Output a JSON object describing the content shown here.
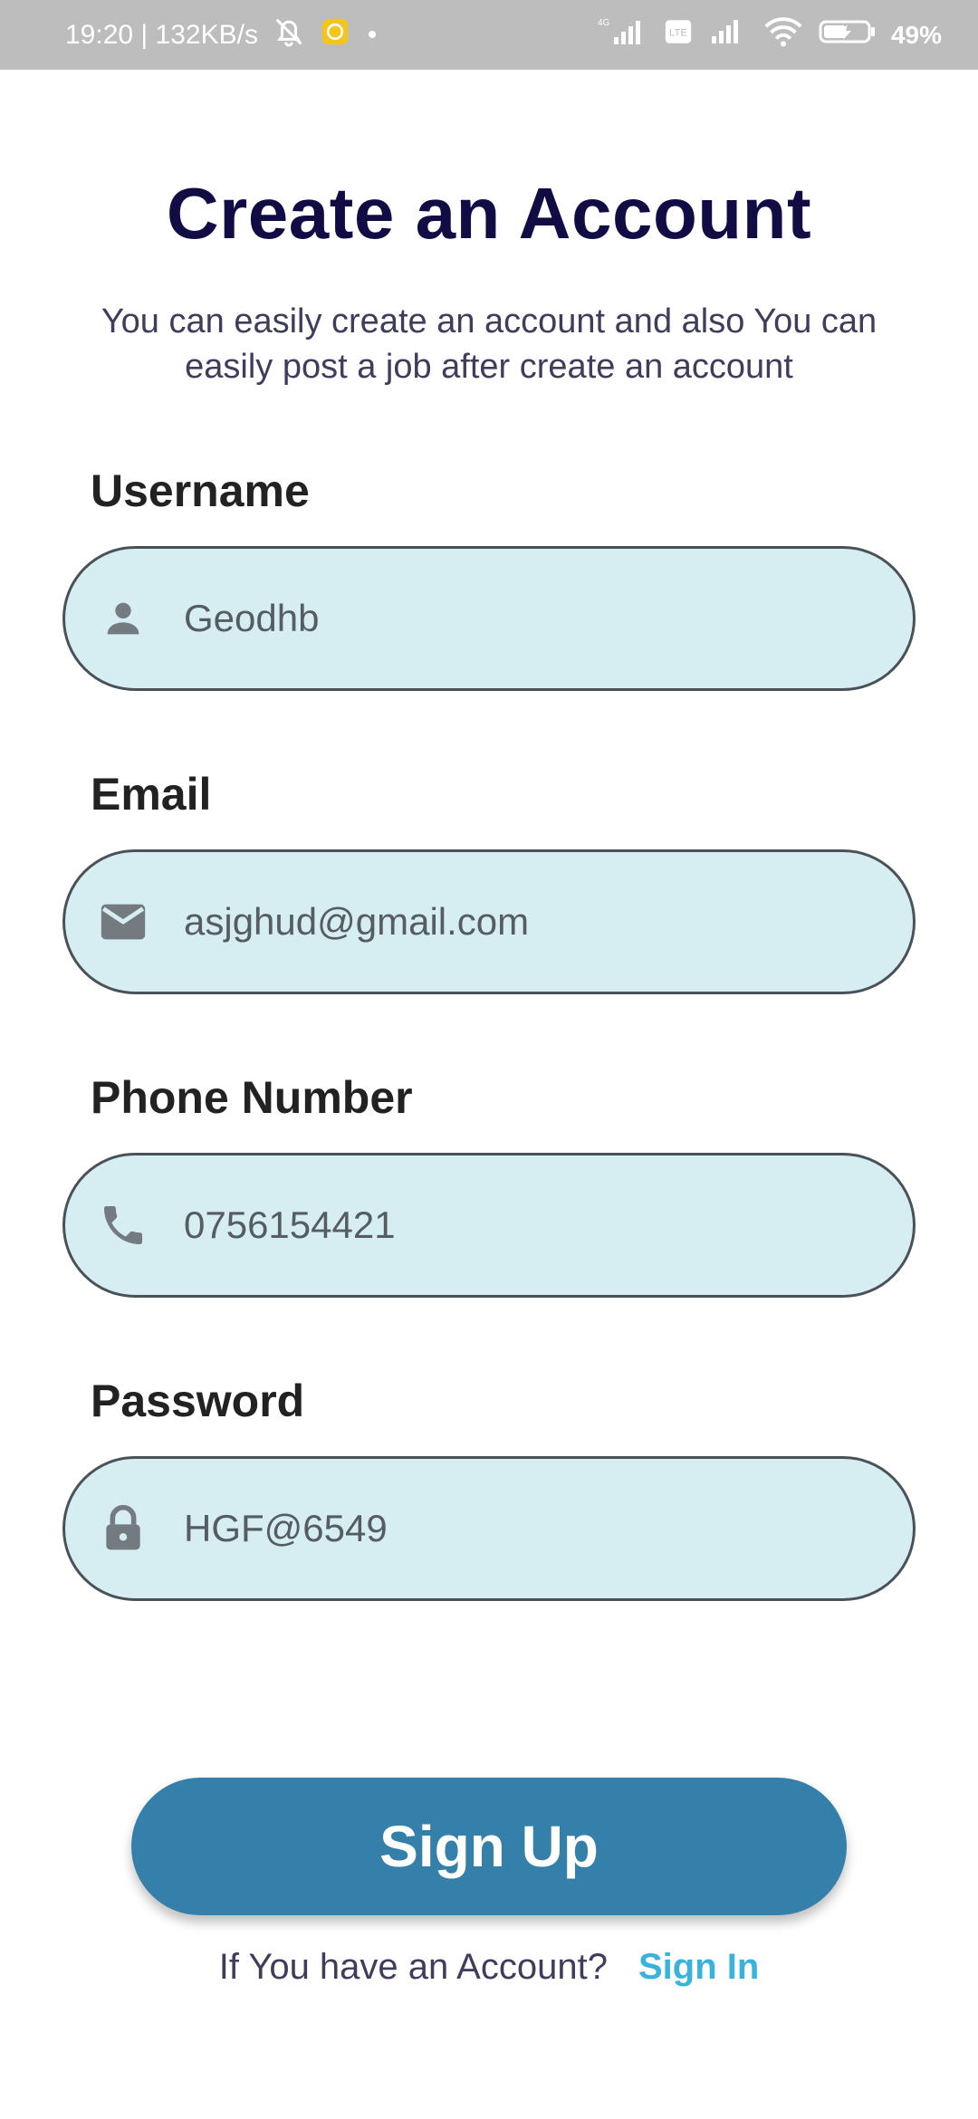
{
  "status_bar": {
    "time_speed": "19:20 | 132KB/s",
    "battery_percent": "49",
    "battery_unit": "%",
    "network_label": "4G",
    "volte_label": "Vo LTE"
  },
  "header": {
    "title": "Create an Account",
    "subtitle": "You can easily create an account and also You can easily post a job after create an account"
  },
  "form": {
    "username": {
      "label": "Username",
      "value": "Geodhb",
      "icon": "person-icon"
    },
    "email": {
      "label": "Email",
      "value": "asjghud@gmail.com",
      "icon": "mail-icon"
    },
    "phone": {
      "label": "Phone Number",
      "value": "0756154421",
      "icon": "phone-icon"
    },
    "password": {
      "label": "Password",
      "value": "HGF@6549",
      "icon": "lock-icon"
    }
  },
  "actions": {
    "signup_label": "Sign Up",
    "account_question": "If You have an Account?",
    "signin_label": "Sign In"
  },
  "colors": {
    "title": "#120c45",
    "field_bg": "#d6eef2",
    "button": "#3580aa",
    "link": "#3ab3dc",
    "status_bar": "#bdbdbd"
  }
}
